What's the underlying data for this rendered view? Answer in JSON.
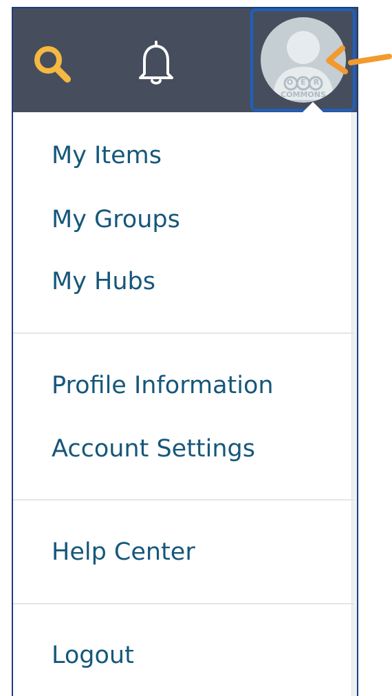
{
  "header": {
    "avatar_text_top": "OER",
    "avatar_text_bottom": "COMMONS"
  },
  "menu": {
    "groups": [
      [
        "My Items",
        "My Groups",
        "My Hubs"
      ],
      [
        "Profile Information",
        "Account Settings"
      ],
      [
        "Help Center"
      ],
      [
        "Logout"
      ]
    ],
    "items": {
      "my_items": "My Items",
      "my_groups": "My Groups",
      "my_hubs": "My Hubs",
      "profile_information": "Profile Information",
      "account_settings": "Account Settings",
      "help_center": "Help Center",
      "logout": "Logout"
    }
  },
  "icons": {
    "search": "search-icon",
    "notifications": "bell-icon",
    "avatar": "user-avatar-icon",
    "annotation": "arrow-pointer-icon"
  },
  "colors": {
    "header_bg": "#464e5d",
    "search_icon": "#f5b841",
    "bell_icon": "#ffffff",
    "menu_text": "#16577a",
    "avatar_focus_border": "#1f5fbf",
    "frame_border": "#1c3e7a",
    "annotation_arrow": "#f29a2e",
    "divider": "#e3e6e8"
  }
}
